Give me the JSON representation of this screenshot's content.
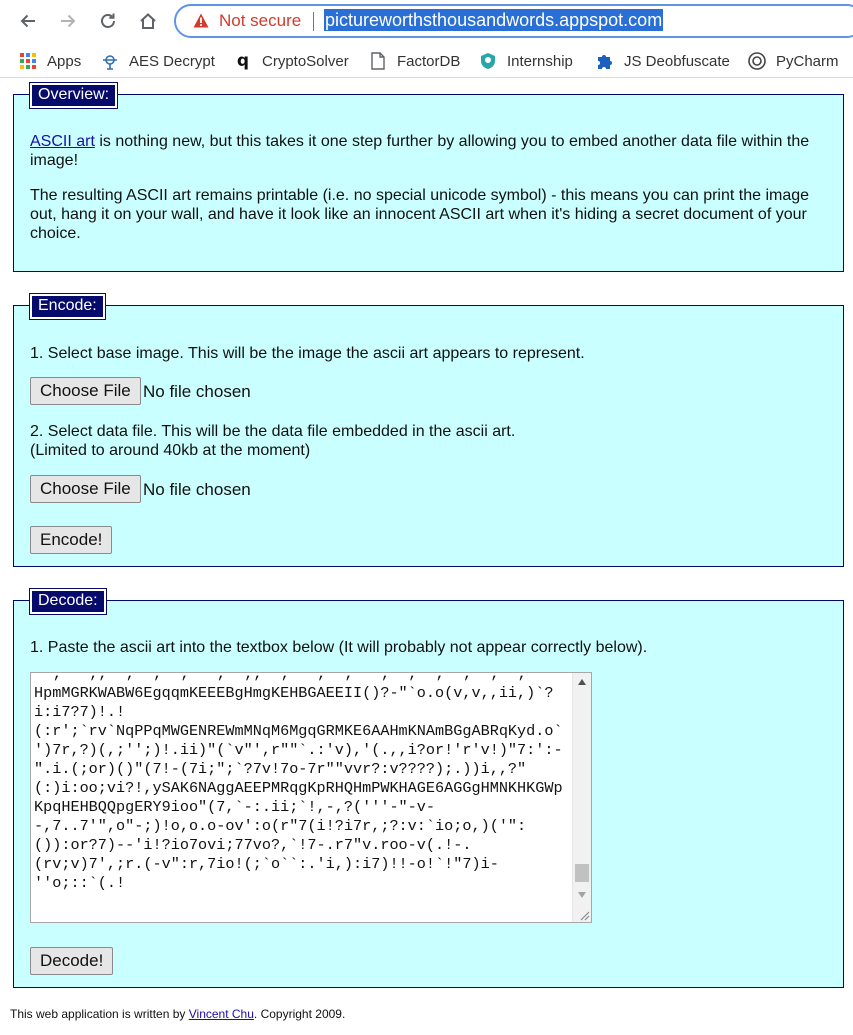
{
  "browser": {
    "security_label": "Not secure",
    "url": "pictureworthsthousandwords.appspot.com",
    "bookmarks": [
      {
        "label": "Apps",
        "icon": "apps-grid-icon"
      },
      {
        "label": "AES Decrypt",
        "icon": "bookmark-favicon"
      },
      {
        "label": "CryptoSolver",
        "icon": "bookmark-favicon"
      },
      {
        "label": "FactorDB",
        "icon": "page-icon"
      },
      {
        "label": "Internship",
        "icon": "bookmark-favicon"
      },
      {
        "label": "JS Deobfuscate",
        "icon": "puzzle-icon"
      },
      {
        "label": "PyCharm",
        "icon": "bookmark-favicon"
      }
    ]
  },
  "overview": {
    "legend": "Overview:",
    "link_text": "ASCII art",
    "para1_rest": " is nothing new, but this takes it one step further by allowing you to embed another data file within the image!",
    "para2": "The resulting ASCII art remains printable (i.e. no special unicode symbol) - this means you can print the image out, hang it on your wall, and have it look like an innocent ASCII art when it's hiding a secret document of your choice."
  },
  "encode": {
    "legend": "Encode:",
    "step1": "1. Select base image. This will be the image the ascii art appears to represent.",
    "step2_line1": "2. Select data file. This will be the data file embedded in the ascii art.",
    "step2_line2": "(Limited to around 40kb at the moment)",
    "choose_file_label": "Choose File",
    "no_file_label": "No file chosen",
    "encode_button": "Encode!"
  },
  "decode": {
    "legend": "Decode:",
    "instruction": "1. Paste the ascii art into the textbox below (It will probably not appear correctly below).",
    "textarea_lines": [
      "  ;   ;;  ;  ;  ;   ;  ;;  ;   ;  ;   ;  ;  ;  ;  ;  ;",
      "HpmMGRKWABW6EgqqmKEEEBgHmgKEHBGAEEII()?-\"`o.o(v,v,,ii,)`?",
      "i:i7?7)!.!",
      "(:r';`rv`NqPPqMWGENREWmMNqM6MgqGRMKE6AAHmKNAmBGgABRqKyd.o`",
      "')7r,?)(,;'';)!.ii)\"(`v\"',r\"\"`.:'v),'(.,,i?or!'r'v!)\"7:':-",
      "\".i.(;or)()\"(7!-(7i;\";`?7v!7o-7r\"\"vvr?:v????);.))i,,?\"",
      "(:)i:oo;vi?!,ySAK6NAggAEEPMRqgKpRHQHmPWKHAGE6AGGgHMNKHKGWp",
      "KpqHEHBQQpgERY9ioo\"(7,`-:.ii;`!,-,?('''-\"-v-",
      "-,7..7'\",o\"-;)!o,o.o-ov':o(r\"7(i!?i7r,;?:v:`io;o,)('\":",
      "()):or?7)--'i!?io7ovi;77vo?,`!7-.r7\"v.roo-v(.!-.",
      "(rv;v)7',;r.(-v\":r,7io!(;`o``:.'i,):i7)!!-o!`!\"7)i-",
      "''o;::`(.!"
    ],
    "decode_button": "Decode!"
  },
  "footer": {
    "prefix": "This web application is written by ",
    "author": "Vincent Chu",
    "suffix": ". Copyright 2009."
  }
}
